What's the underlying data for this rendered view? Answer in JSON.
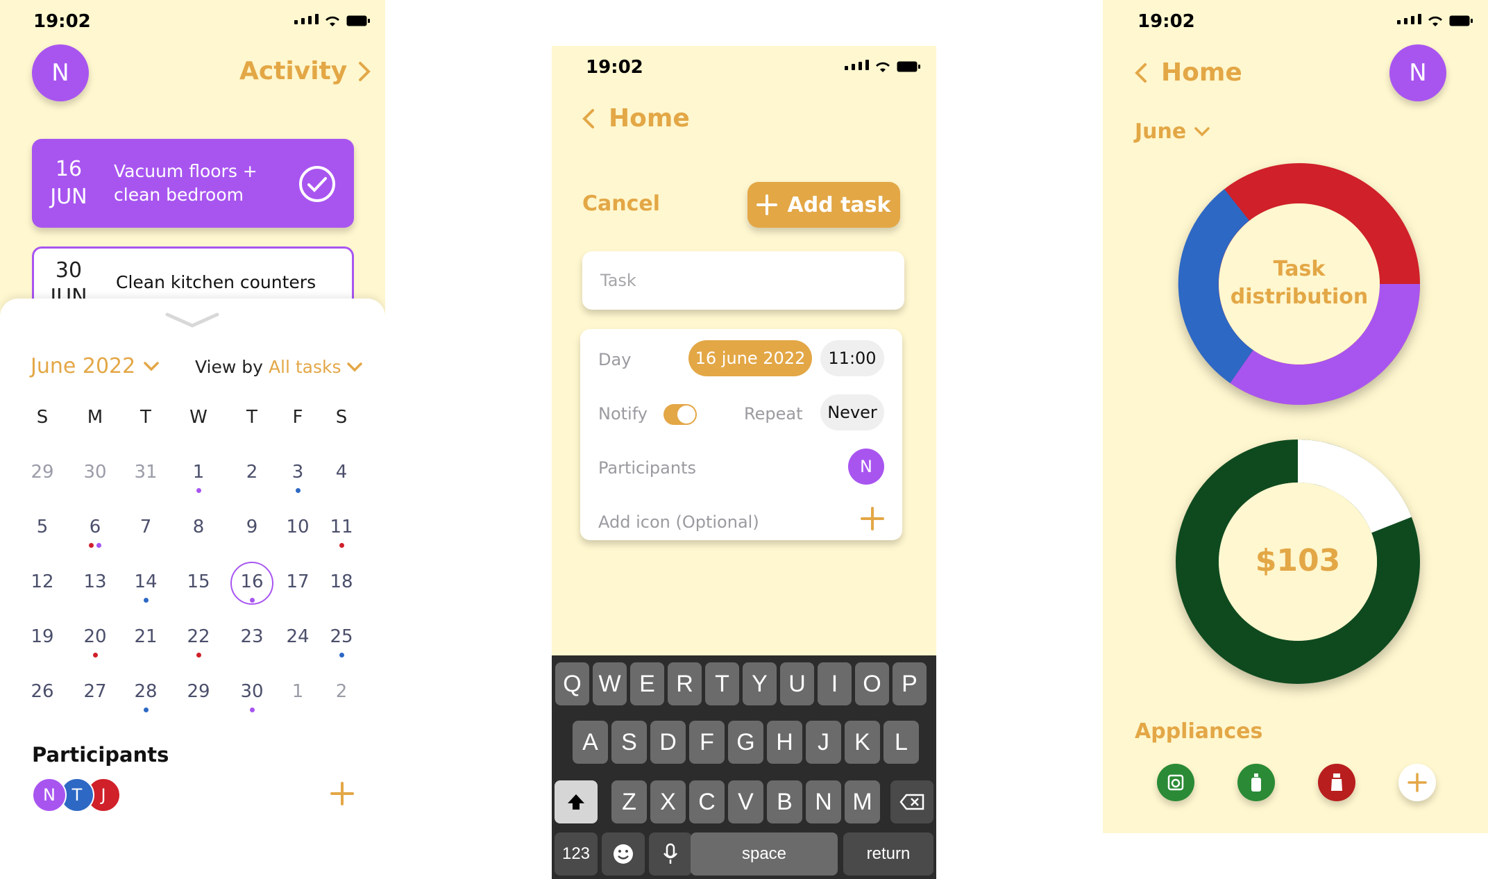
{
  "left": {
    "status_time": "19:02",
    "avatar": "N",
    "activity_link": "Activity",
    "tasks": [
      {
        "day": "16",
        "month": "JUN",
        "title_line1": "Vacuum floors +",
        "title_line2": "clean bedroom"
      },
      {
        "day": "30",
        "month": "JUN",
        "title": "Clean kitchen counters"
      }
    ],
    "month_selector": "June 2022",
    "view_by_label": "View by",
    "view_by_value": "All tasks",
    "weekdays": [
      "S",
      "M",
      "T",
      "W",
      "T",
      "F",
      "S"
    ],
    "weeks": [
      [
        "29",
        "30",
        "31",
        "1",
        "2",
        "3",
        "4"
      ],
      [
        "5",
        "6",
        "7",
        "8",
        "9",
        "10",
        "11"
      ],
      [
        "12",
        "13",
        "14",
        "15",
        "16",
        "17",
        "18"
      ],
      [
        "19",
        "20",
        "21",
        "22",
        "23",
        "24",
        "25"
      ],
      [
        "26",
        "27",
        "28",
        "29",
        "30",
        "1",
        "2"
      ]
    ],
    "selected_day": "16",
    "participants_title": "Participants",
    "participants": [
      "N",
      "T",
      "J"
    ],
    "colors": {
      "background": "#fff7cf",
      "accent": "#a855f0",
      "gold": "#e3a746",
      "blue": "#2d68c4",
      "red": "#d0202a"
    }
  },
  "middle": {
    "status_time": "19:02",
    "back_label": "Home",
    "cancel_label": "Cancel",
    "add_task_label": "Add task",
    "task_placeholder": "Task",
    "day_label": "Day",
    "date_value": "16 june 2022",
    "time_value": "11:00",
    "notify_label": "Notify",
    "notify_on": true,
    "repeat_label": "Repeat",
    "repeat_value": "Never",
    "participants_label": "Participants",
    "participant_avatar": "N",
    "add_icon_label": "Add icon (Optional)",
    "keyboard": {
      "row1": [
        "Q",
        "W",
        "E",
        "R",
        "T",
        "Y",
        "U",
        "I",
        "O",
        "P"
      ],
      "row2": [
        "A",
        "S",
        "D",
        "F",
        "G",
        "H",
        "J",
        "K",
        "L"
      ],
      "row3": [
        "Z",
        "X",
        "C",
        "V",
        "B",
        "N",
        "M"
      ],
      "numbers_key": "123",
      "space_key": "space",
      "return_key": "return"
    }
  },
  "right": {
    "status_time": "19:02",
    "back_label": "Home",
    "avatar": "N",
    "month_selector": "June",
    "distribution_title_line1": "Task",
    "distribution_title_line2": "distribution",
    "distribution_colors": [
      "#d0202a",
      "#a855f0",
      "#2d68c4"
    ],
    "money_value": "$103",
    "money_colors": {
      "spent": "#0f4a1f",
      "remaining": "#ffffff"
    },
    "appliances_title": "Appliances",
    "appliance_icons": [
      "washer-icon",
      "bottle-icon",
      "spray-icon"
    ],
    "appliance_colors": [
      "#2a8a35",
      "#2a8a35",
      "#b81e1e"
    ]
  }
}
